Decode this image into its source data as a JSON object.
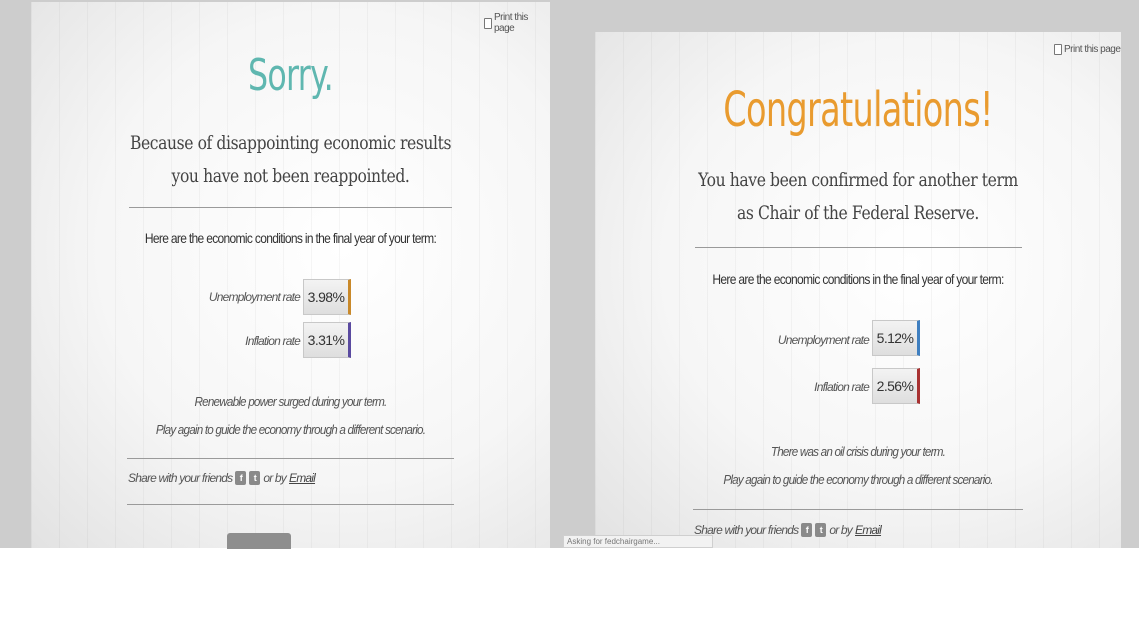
{
  "left_panel": {
    "print_label": "Print this page",
    "heading": "Sorry.",
    "subtitle_line1": "Because of disappointing economic results",
    "subtitle_line2": "you have not been reappointed.",
    "conditions_heading": "Here are the economic conditions in the final year of your term:",
    "unemployment_label": "Unemployment rate",
    "unemployment_value": "3.98%",
    "inflation_label": "Inflation rate",
    "inflation_value": "3.31%",
    "note_line1": "Renewable power surged during your term.",
    "note_line2": "Play again to guide the economy through a different scenario.",
    "share_text": "Share with your friends",
    "share_or": "or by",
    "email_label": "Email"
  },
  "right_panel": {
    "print_label": "Print this page",
    "heading": "Congratulations!",
    "subtitle_line1": "You have been confirmed for another term",
    "subtitle_line2": "as Chair of the Federal Reserve.",
    "conditions_heading": "Here are the economic conditions in the final year of your term:",
    "unemployment_label": "Unemployment rate",
    "unemployment_value": "5.12%",
    "inflation_label": "Inflation rate",
    "inflation_value": "2.56%",
    "note_line1": "There was an oil crisis during your term.",
    "note_line2": "Play again to guide the economy through a different scenario.",
    "share_text": "Share with your friends",
    "share_or": "or by",
    "email_label": "Email"
  },
  "status_tip": "Asking for fedchairgame...",
  "colors": {
    "sorry_heading": "#5fb7b0",
    "congrats_heading": "#e99b2f",
    "left_unemployment_accent": "#c9892a",
    "left_inflation_accent": "#5a4aa0",
    "right_unemployment_accent": "#3f7fc0",
    "right_inflation_accent": "#a83232"
  },
  "icons": {
    "print": "printer-icon",
    "facebook": "facebook-icon",
    "twitter": "twitter-icon"
  }
}
